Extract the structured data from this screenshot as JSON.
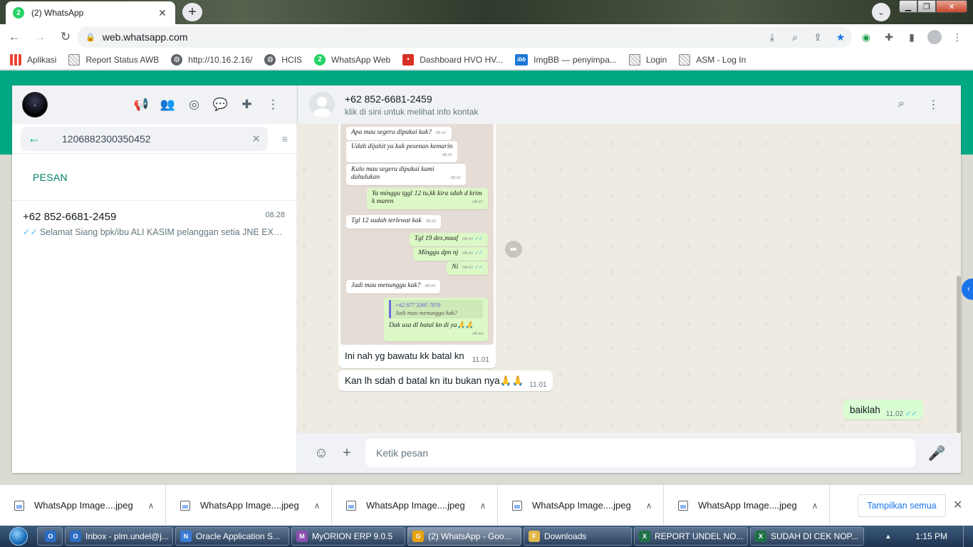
{
  "browser": {
    "tab_title": "(2) WhatsApp",
    "tab_badge": "2",
    "url": "web.whatsapp.com",
    "bookmarks": [
      {
        "label": "Aplikasi",
        "icon": "apps-grid-icon"
      },
      {
        "label": "Report Status AWB",
        "icon": "page-icon"
      },
      {
        "label": "http://10.16.2.16/",
        "icon": "globe-icon"
      },
      {
        "label": "HCIS",
        "icon": "globe-icon"
      },
      {
        "label": "WhatsApp Web",
        "icon": "whatsapp-icon"
      },
      {
        "label": "Dashboard HVO HV...",
        "icon": "dashboard-icon"
      },
      {
        "label": "ImgBB — penyimpa...",
        "icon": "imgbb-icon"
      },
      {
        "label": "Login",
        "icon": "page-icon"
      },
      {
        "label": "ASM - Log In",
        "icon": "page-icon"
      }
    ]
  },
  "sidebar": {
    "search_query": "1206882300350452",
    "section_label": "PESAN",
    "result": {
      "name": "+62 852-6681-2459",
      "time": "08.28",
      "preview": "Selamat Siang   bpk/ibu ALI KASIM pelanggan setia JNE EXP..."
    }
  },
  "chat": {
    "contact_name": "+62 852-6681-2459",
    "contact_sub": "klik di sini untuk melihat info kontak",
    "image_message": {
      "screenshot_bubbles": [
        {
          "dir": "in",
          "text": "Apa mau segera dipakai kak?",
          "time": "08.41"
        },
        {
          "dir": "in",
          "text": "Udah dijahit ya kak pesenan kemarin",
          "time": "08.41"
        },
        {
          "dir": "in",
          "text": "Kalo mau segera dipakai kami dahulukan",
          "time": "08.42"
        },
        {
          "dir": "out",
          "text": "Ya minggu tggl 12 tu,kk kira sdah d krim k maren",
          "time": "08.42"
        },
        {
          "dir": "in",
          "text": "Tgl 12 sudah terlewat kak",
          "time": "08.42"
        },
        {
          "dir": "out",
          "text": "Tgl 19 dex,maaf",
          "time": "08.43"
        },
        {
          "dir": "out",
          "text": "Minggu dpn nj",
          "time": "08.43"
        },
        {
          "dir": "out",
          "text": "Ni",
          "time": "08.43"
        },
        {
          "dir": "in",
          "text": "Jadi mau menunggu kak?",
          "time": "08.44"
        }
      ],
      "quoted_name": "+62 877 3395 7070",
      "quoted_text": "Jadi mau menunggu kak?",
      "reply_text": "Dak usa dl batal kn di ya🙏🙏",
      "reply_time": "08.44",
      "caption": "Ini nah yg bawatu kk batal kn",
      "time": "11.01"
    },
    "messages": [
      {
        "dir": "in",
        "text": "Kan lh sdah d batal kn itu bukan nya🙏🙏",
        "time": "11.01"
      },
      {
        "dir": "out",
        "text": "baiklah",
        "time": "11.02"
      }
    ],
    "composer_placeholder": "Ketik pesan"
  },
  "downloads": {
    "items": [
      "WhatsApp Image....jpeg",
      "WhatsApp Image....jpeg",
      "WhatsApp Image....jpeg",
      "WhatsApp Image....jpeg",
      "WhatsApp Image....jpeg"
    ],
    "show_all": "Tampilkan semua"
  },
  "taskbar": {
    "items": [
      {
        "label": "Inbox - plm.undel@j...",
        "color": "#2b6cc4",
        "glyph": "O"
      },
      {
        "label": "Oracle Application S...",
        "color": "#3a7bd5",
        "glyph": "N"
      },
      {
        "label": "MyORION ERP 9.0.5",
        "color": "#8a4fb0",
        "glyph": "M"
      },
      {
        "label": "(2) WhatsApp - Goo...",
        "color": "#e8a20c",
        "glyph": "G"
      },
      {
        "label": "Downloads",
        "color": "#e0b84b",
        "glyph": "F"
      },
      {
        "label": "REPORT UNDEL NO...",
        "color": "#1e7145",
        "glyph": "X"
      },
      {
        "label": "SUDAH DI CEK NOP...",
        "color": "#1e7145",
        "glyph": "X"
      }
    ],
    "clock": "1:15 PM"
  }
}
